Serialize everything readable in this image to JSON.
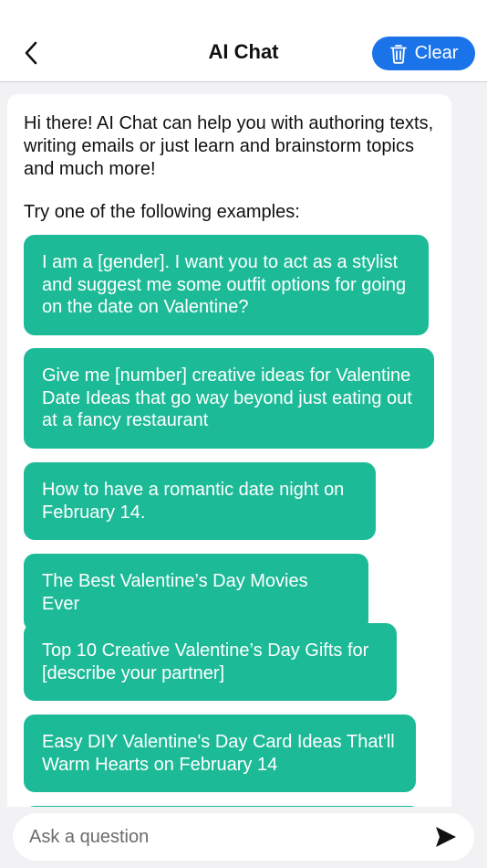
{
  "header": {
    "title": "AI Chat",
    "clear_label": "Clear"
  },
  "chat": {
    "intro": "Hi there! AI Chat can help you with authoring texts, writing emails or just learn and brainstorm topics and much more!",
    "try_label": "Try one of the following examples:",
    "examples": [
      "I am a [gender]. I want you to act as a stylist and suggest me some outfit options for going on the date on Valentine?",
      "Give me [number] creative ideas for Valentine Date Ideas that go way beyond just eating out at a fancy restaurant",
      "How to have a romantic date night on February 14.",
      "The Best Valentine’s Day Movies Ever",
      "Top 10 Creative Valentine’s Day Gifts for [describe your partner]",
      "Easy DIY Valentine's Day Card Ideas That'll Warm Hearts on February 14"
    ]
  },
  "input": {
    "placeholder": "Ask a question"
  },
  "colors": {
    "accent": "#1a73e8",
    "example_bg": "#1dba97",
    "background": "#f2f2f4"
  },
  "icons": {
    "back": "chevron-left-icon",
    "clear": "trash-icon",
    "send": "send-icon"
  }
}
